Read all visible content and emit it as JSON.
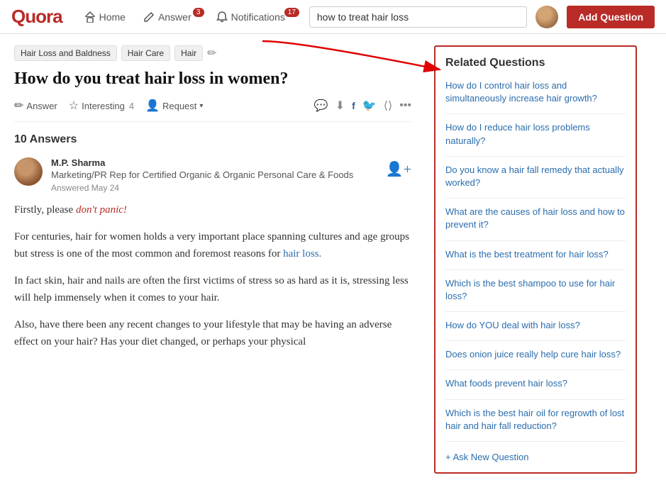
{
  "header": {
    "logo": "Quora",
    "nav": [
      {
        "label": "Home",
        "icon": "home",
        "badge": null
      },
      {
        "label": "Answer",
        "icon": "edit",
        "badge": "3"
      },
      {
        "label": "Notifications",
        "icon": "bell",
        "badge": "17"
      }
    ],
    "search": {
      "placeholder": "how to treat hair loss",
      "value": "how to treat hair loss"
    },
    "add_question_label": "Add Question"
  },
  "breadcrumb": {
    "items": [
      "Hair Loss and Baldness",
      "Hair Care",
      "Hair"
    ]
  },
  "question": {
    "title": "How do you treat hair loss in women?"
  },
  "actions": {
    "answer": "Answer",
    "interesting": "Interesting",
    "interesting_count": "4",
    "request": "Request"
  },
  "answers": {
    "count_label": "10 Answers",
    "items": [
      {
        "author": "M.P. Sharma",
        "bio": "Marketing/PR Rep for Certified Organic & Organic Personal Care & Foods",
        "date": "Answered May 24",
        "paragraphs": [
          "Firstly, please don't panic!",
          "For centuries, hair for women holds a very important place spanning cultures and age groups but stress is one of the most common and foremost reasons for hair loss.",
          "In fact skin, hair and nails are often the first victims of stress so as hard as it is, stressing less will help immensely when it comes to your hair.",
          "Also, have there been any recent changes to your lifestyle that may be having an adverse effect on your hair? Has your diet changed, or perhaps your physical"
        ]
      }
    ]
  },
  "sidebar": {
    "title": "Related Questions",
    "questions": [
      "How do I control hair loss and simultaneously increase hair growth?",
      "How do I reduce hair loss problems naturally?",
      "Do you know a hair fall remedy that actually worked?",
      "What are the causes of hair loss and how to prevent it?",
      "What is the best treatment for hair loss?",
      "Which is the best shampoo to use for hair loss?",
      "How do YOU deal with hair loss?",
      "Does onion juice really help cure hair loss?",
      "What foods prevent hair loss?",
      "Which is the best hair oil for regrowth of lost hair and hair fall reduction?"
    ],
    "ask_new": "+ Ask New Question"
  }
}
